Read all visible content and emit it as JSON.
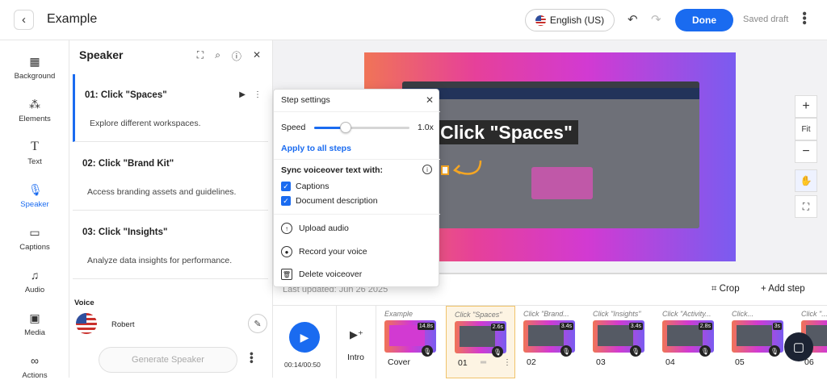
{
  "header": {
    "title": "Example",
    "language": "English (US)",
    "done_label": "Done",
    "status": "Saved draft"
  },
  "rail": {
    "items": [
      {
        "label": "Background",
        "icon": "background-icon"
      },
      {
        "label": "Elements",
        "icon": "elements-icon"
      },
      {
        "label": "Text",
        "icon": "text-icon"
      },
      {
        "label": "Speaker",
        "icon": "microphone-icon"
      },
      {
        "label": "Captions",
        "icon": "captions-icon"
      },
      {
        "label": "Audio",
        "icon": "music-icon"
      },
      {
        "label": "Media",
        "icon": "image-icon"
      },
      {
        "label": "Actions",
        "icon": "link-icon"
      }
    ]
  },
  "panel": {
    "title": "Speaker",
    "steps": [
      {
        "title": "01: Click \"Spaces\"",
        "text": "Explore different workspaces."
      },
      {
        "title": "02: Click \"Brand Kit\"",
        "text": "Access branding assets and guidelines."
      },
      {
        "title": "03: Click \"Insights\"",
        "text": "Analyze data insights for performance."
      }
    ],
    "voice_label": "Voice",
    "voice_name": "Robert",
    "generate_label": "Generate Speaker"
  },
  "popover": {
    "title": "Step settings",
    "speed_label": "Speed",
    "speed_value": "1.0x",
    "speed_fraction": 0.33,
    "apply_all": "Apply to all steps",
    "sync_label": "Sync voiceover text with:",
    "options": [
      {
        "label": "Captions",
        "checked": true
      },
      {
        "label": "Document description",
        "checked": true
      }
    ],
    "actions": [
      {
        "label": "Upload audio",
        "icon": "upload-cloud-icon"
      },
      {
        "label": "Record your voice",
        "icon": "record-icon"
      },
      {
        "label": "Delete voiceover",
        "icon": "trash-icon"
      }
    ]
  },
  "canvas": {
    "caption": "Click \"Spaces\"",
    "zoom_fit": "Fit"
  },
  "toolbar": {
    "updated": "Last updated: Jun 26 2025",
    "crop": "Crop",
    "add_step": "Add step"
  },
  "timeline": {
    "time": "00:14/00:50",
    "intro": "Intro",
    "thumbs": [
      {
        "label": "Example",
        "duration": "14.8s",
        "name": "Cover"
      },
      {
        "label": "Click \"Spaces\"",
        "duration": "2.6s",
        "name": "01"
      },
      {
        "label": "Click \"Brand...",
        "duration": "3.4s",
        "name": "02"
      },
      {
        "label": "Click \"Insights\"",
        "duration": "3.4s",
        "name": "03"
      },
      {
        "label": "Click \"Activity...",
        "duration": "2.8s",
        "name": "04"
      },
      {
        "label": "Click...",
        "duration": "3s",
        "name": "05"
      },
      {
        "label": "Click \"...",
        "duration": "",
        "name": "06"
      }
    ]
  },
  "colors": {
    "accent": "#1a6bf0",
    "selected_thumb": "#fdf4e3"
  }
}
